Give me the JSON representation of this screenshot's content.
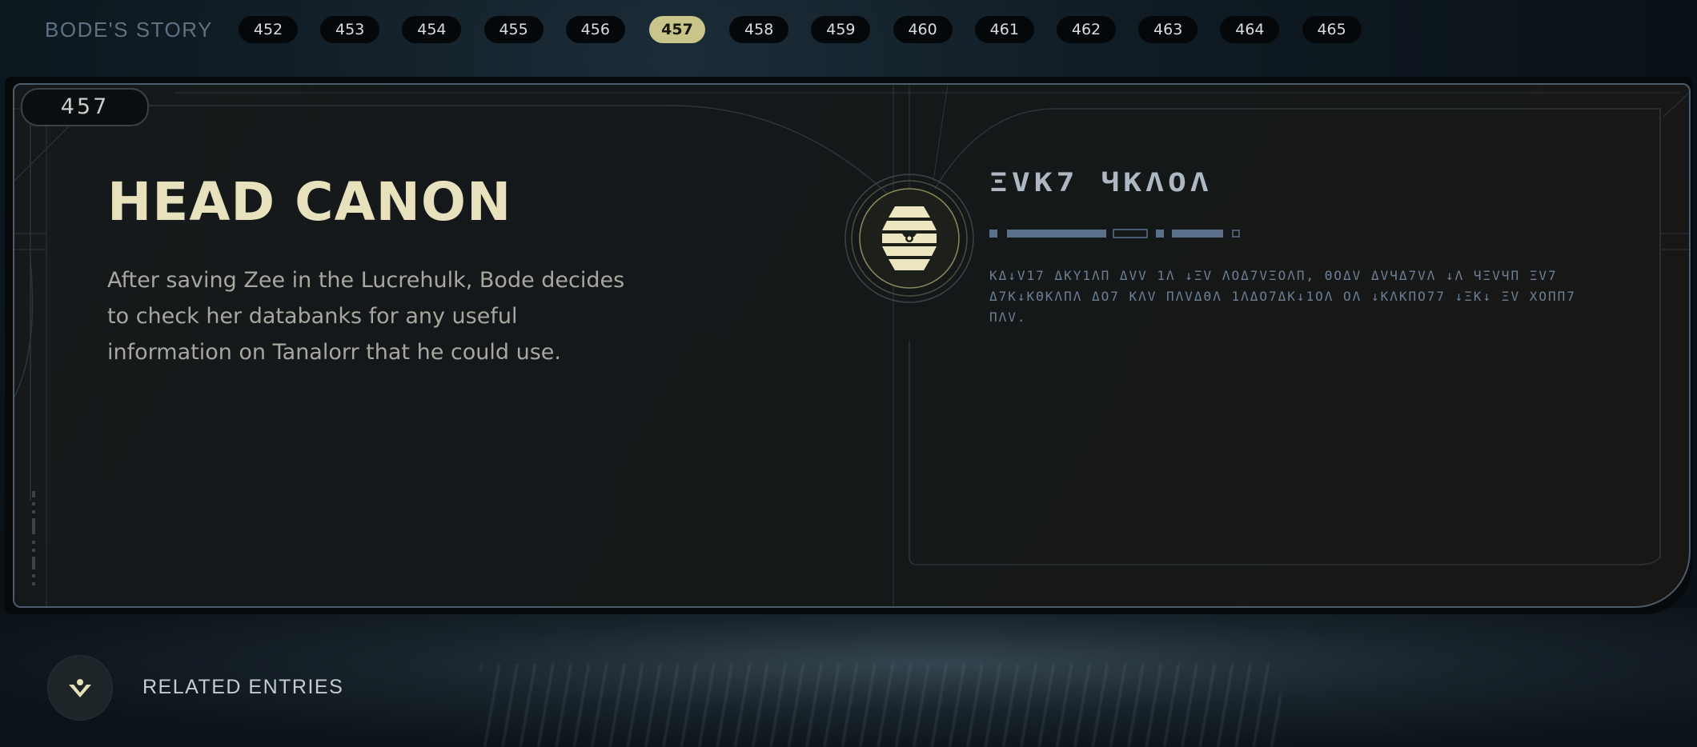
{
  "header": {
    "story_title": "BODE'S STORY",
    "chapters": [
      "452",
      "453",
      "454",
      "455",
      "456",
      "457",
      "458",
      "459",
      "460",
      "461",
      "462",
      "463",
      "464",
      "465"
    ],
    "active_chapter": "457"
  },
  "entry": {
    "number": "457",
    "title": "HEAD CANON",
    "description": "After saving Zee in the Lucrehulk, Bode decides to check her databanks for any useful information on Tanalorr that he could use.",
    "aurebesh_title": "ΞVK7 ЧKΛOΛ",
    "aurebesh_body": "KΔ↓V17 ΔKY1ΛΠ ΔVV 1Λ ↓ΞV ΛOΔ7VΞOΛΠ, ΘOΔV ΔVЧΔ7VΛ ↓Λ ЧΞVЧΠ ΞV7 Δ7K↓KΘKΛΠΛ ΔO7 KΛV ΠΛVΔΘΛ 1ΛΔO7ΔK↓1OΛ OΛ ↓KΛKΠO77 ↓ΞK↓ ΞV ΧOΠΠ7 ΠΛV."
  },
  "related": {
    "label": "RELATED ENTRIES",
    "icon": "related-person-icon"
  },
  "colors": {
    "accent": "#c8c48a",
    "title": "#e7e2bd",
    "panel_border": "#4d5a68"
  }
}
